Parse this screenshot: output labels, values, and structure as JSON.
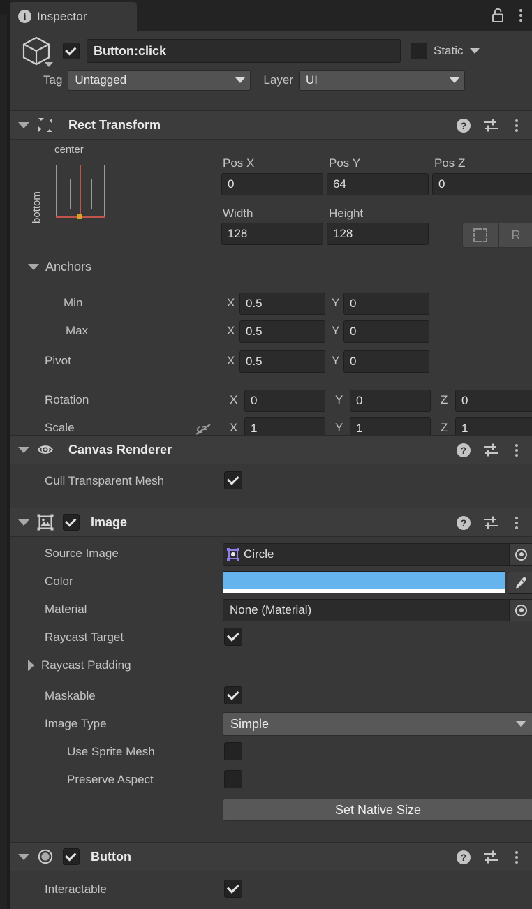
{
  "window": {
    "tab_label": "Inspector",
    "tab_icon": "info-icon",
    "lock_icon": "unlocked-padlock-icon",
    "menu_icon": "kebab-menu-icon"
  },
  "gameobject": {
    "icon": "cube-icon",
    "enabled": true,
    "name": "Button:click",
    "static_label": "Static",
    "static_checked": false,
    "tag_label": "Tag",
    "tag_value": "Untagged",
    "layer_label": "Layer",
    "layer_value": "UI"
  },
  "rect_transform": {
    "title": "Rect Transform",
    "icon": "rect-transform-icon",
    "expanded": true,
    "anchor_preset": {
      "horizontal": "center",
      "vertical": "bottom"
    },
    "pos": {
      "labels": [
        "Pos X",
        "Pos Y",
        "Pos Z"
      ],
      "values": [
        "0",
        "64",
        "0"
      ]
    },
    "size": {
      "labels": [
        "Width",
        "Height"
      ],
      "values": [
        "128",
        "128"
      ]
    },
    "blueprint_button": "blueprint-mode-icon",
    "raw_button": "R",
    "anchors_label": "Anchors",
    "anchors": [
      {
        "label": "Min",
        "x_axis": "X",
        "x": "0.5",
        "y_axis": "Y",
        "y": "0"
      },
      {
        "label": "Max",
        "x_axis": "X",
        "x": "0.5",
        "y_axis": "Y",
        "y": "0"
      }
    ],
    "pivot": {
      "label": "Pivot",
      "x_axis": "X",
      "x": "0.5",
      "y_axis": "Y",
      "y": "0"
    },
    "rotation": {
      "label": "Rotation",
      "axes": [
        "X",
        "Y",
        "Z"
      ],
      "values": [
        "0",
        "0",
        "0"
      ]
    },
    "scale": {
      "label": "Scale",
      "link_icon": "broken-link-icon",
      "axes": [
        "X",
        "Y",
        "Z"
      ],
      "values": [
        "1",
        "1",
        "1"
      ]
    }
  },
  "canvas_renderer": {
    "title": "Canvas Renderer",
    "icon": "eye-icon",
    "expanded": true,
    "cull_label": "Cull Transparent Mesh",
    "cull_checked": true
  },
  "image": {
    "title": "Image",
    "icon": "image-component-icon",
    "enabled": true,
    "expanded": true,
    "source_image_label": "Source Image",
    "source_image_value": "Circle",
    "color_label": "Color",
    "color_value": "#66b4ee",
    "material_label": "Material",
    "material_value": "None (Material)",
    "raycast_target_label": "Raycast Target",
    "raycast_target_checked": true,
    "raycast_padding_label": "Raycast Padding",
    "raycast_padding_expanded": false,
    "maskable_label": "Maskable",
    "maskable_checked": true,
    "image_type_label": "Image Type",
    "image_type_value": "Simple",
    "use_sprite_mesh_label": "Use Sprite Mesh",
    "use_sprite_mesh_checked": false,
    "preserve_aspect_label": "Preserve Aspect",
    "preserve_aspect_checked": false,
    "set_native_size_label": "Set Native Size"
  },
  "button": {
    "title": "Button",
    "icon": "button-component-icon",
    "enabled": true,
    "expanded": true,
    "interactable_label": "Interactable",
    "interactable_checked": true
  },
  "component_header_icons": {
    "help": "?",
    "preset": "preset-slider-icon",
    "menu": "kebab-menu-icon"
  }
}
